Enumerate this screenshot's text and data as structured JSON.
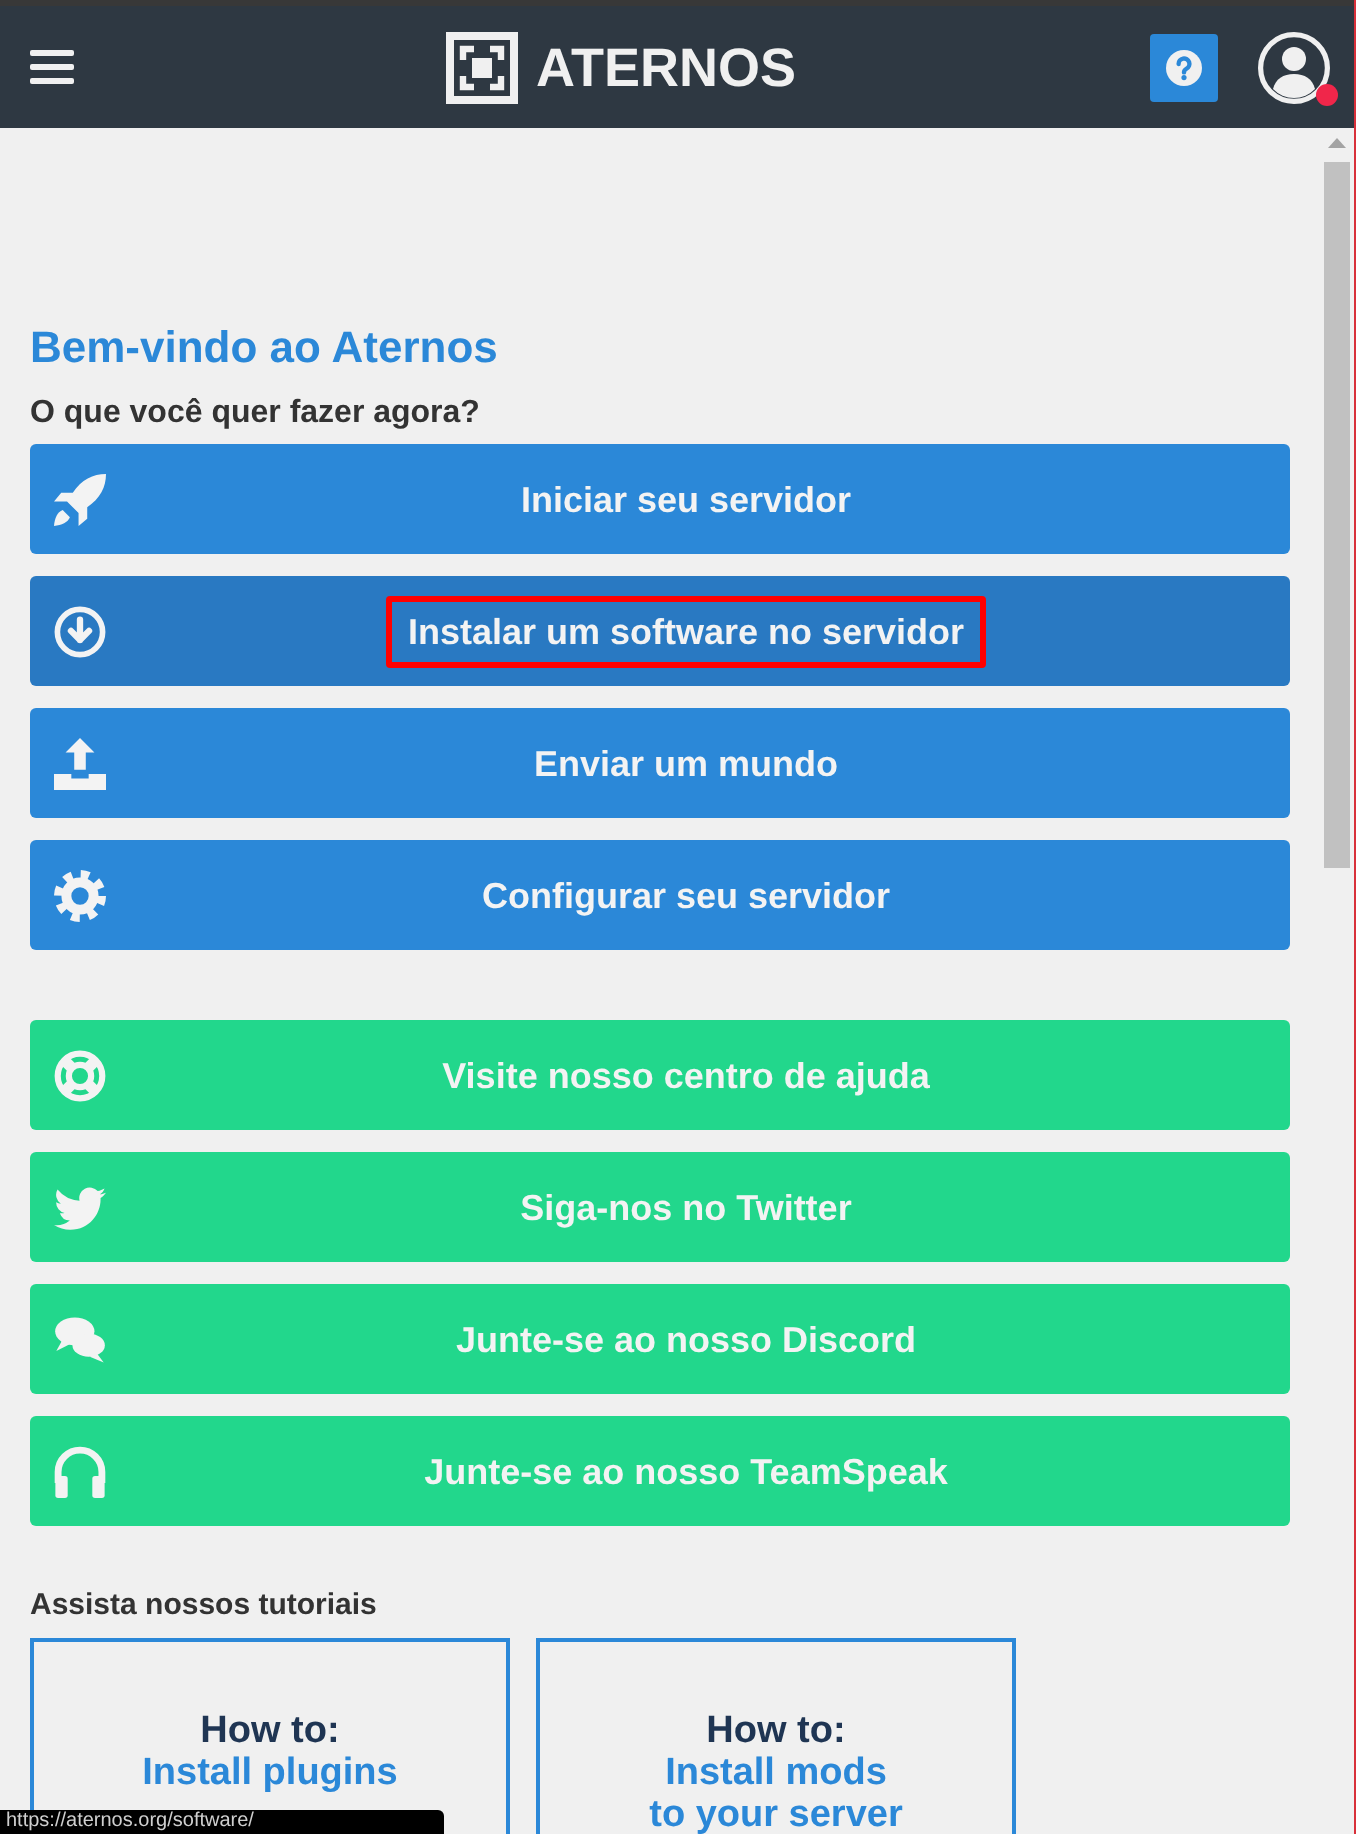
{
  "header": {
    "logo_text": "ATERNOS",
    "notification": true
  },
  "welcome": {
    "title": "Bem-vindo ao Aternos",
    "subtitle": "O que você quer fazer agora?"
  },
  "action_buttons": [
    {
      "label": "Iniciar seu servidor",
      "kind": "rocket",
      "hovered": false,
      "highlighted": false
    },
    {
      "label": "Instalar um software no servidor",
      "kind": "download",
      "hovered": true,
      "highlighted": true
    },
    {
      "label": "Enviar um mundo",
      "kind": "upload",
      "hovered": false,
      "highlighted": false
    },
    {
      "label": "Configurar seu servidor",
      "kind": "gear",
      "hovered": false,
      "highlighted": false
    }
  ],
  "community_buttons": [
    {
      "label": "Visite nosso centro de ajuda",
      "kind": "lifebuoy",
      "hovered": false,
      "highlighted": false
    },
    {
      "label": "Siga-nos no Twitter",
      "kind": "bird",
      "hovered": false,
      "highlighted": false
    },
    {
      "label": "Junte-se ao nosso Discord",
      "kind": "chat",
      "hovered": false,
      "highlighted": false
    },
    {
      "label": "Junte-se ao nosso TeamSpeak",
      "kind": "headphones",
      "hovered": false,
      "highlighted": false
    }
  ],
  "tutorials": {
    "title": "Assista nossos tutoriais",
    "cards": [
      {
        "heading": "How to:",
        "lines": [
          "Install plugins"
        ]
      },
      {
        "heading": "How to:",
        "lines": [
          "Install mods",
          "to your server"
        ]
      }
    ]
  },
  "status_bar": {
    "url": "https://aternos.org/software/"
  }
}
